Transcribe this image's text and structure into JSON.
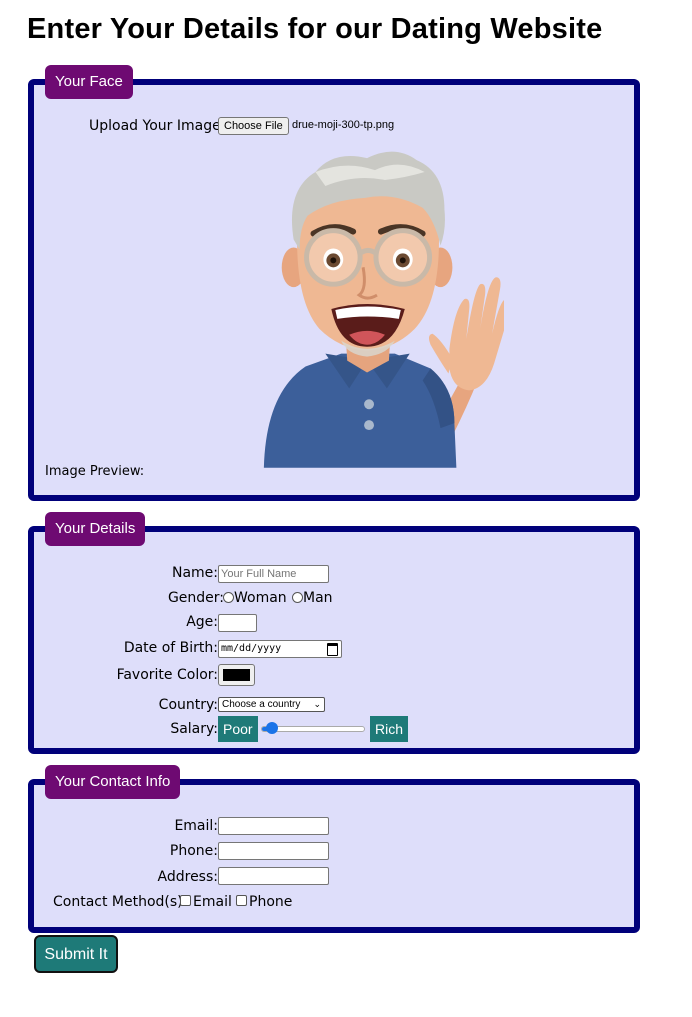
{
  "page": {
    "title": "Enter Your Details for our Dating Website"
  },
  "face": {
    "legend": "Your Face",
    "upload_label": "Upload Your Image:",
    "choose_file": "Choose File",
    "file_name": "drue-moji-300-tp.png",
    "preview_label": "Image Preview:"
  },
  "details": {
    "legend": "Your Details",
    "name_label": "Name:",
    "name_placeholder": "Your Full Name",
    "gender_label": "Gender:",
    "gender_options": [
      "Woman",
      "Man"
    ],
    "age_label": "Age:",
    "age_value": "",
    "dob_label": "Date of Birth:",
    "dob_placeholder": "mm/dd/yyyy",
    "color_label": "Favorite Color:",
    "color_value": "#000000",
    "country_label": "Country:",
    "country_selected": "Choose a country",
    "salary_label": "Salary:",
    "salary_min_label": "Poor",
    "salary_max_label": "Rich",
    "salary_value": 0.1
  },
  "contact": {
    "legend": "Your Contact Info",
    "email_label": "Email:",
    "phone_label": "Phone:",
    "address_label": "Address:",
    "method_label": "Contact Method(s)",
    "method_options": [
      "Email",
      "Phone"
    ]
  },
  "submit_label": "Submit It",
  "colors": {
    "panel_bg": "#dedefa",
    "panel_border": "#00007a",
    "legend_bg": "#6e0a72",
    "teal": "#1e7a78"
  }
}
